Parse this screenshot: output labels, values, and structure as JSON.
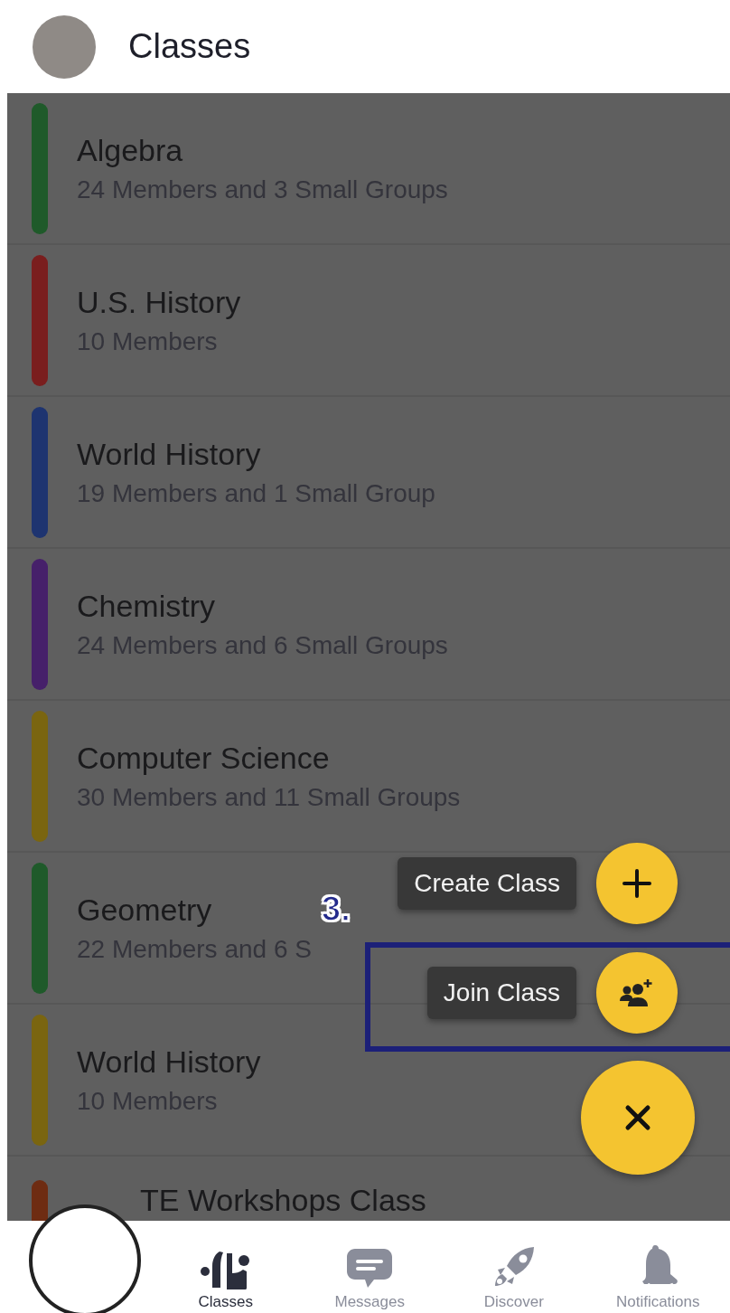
{
  "header": {
    "title": "Classes"
  },
  "classes": [
    {
      "name": "Algebra",
      "details": "24 Members and 3 Small Groups",
      "color": "#1f5a2a"
    },
    {
      "name": "U.S. History",
      "details": "10 Members",
      "color": "#7a1e1e"
    },
    {
      "name": "World History",
      "details": "19 Members and 1 Small Group",
      "color": "#1e3470"
    },
    {
      "name": "Chemistry",
      "details": "24 Members and 6 Small Groups",
      "color": "#46206a"
    },
    {
      "name": "Computer Science",
      "details": "30 Members and 11 Small Groups",
      "color": "#7a6510"
    },
    {
      "name": "Geometry",
      "details": "22 Members and 6 S",
      "color": "#1f5a2a"
    },
    {
      "name": "World History",
      "details": "10 Members",
      "color": "#7a6510"
    },
    {
      "name": "TE Workshops Class",
      "color": "#6e2c12"
    }
  ],
  "fab_menu": {
    "expanded": true,
    "actions": [
      {
        "label": "Create Class",
        "kind": "create"
      },
      {
        "label": "Join Class",
        "kind": "join"
      }
    ]
  },
  "annotation": {
    "step": "3."
  },
  "nav": [
    {
      "label": "Classes",
      "kind": "classes",
      "selected": true
    },
    {
      "label": "Messages",
      "kind": "messages",
      "selected": false
    },
    {
      "label": "Discover",
      "kind": "discover",
      "selected": false
    },
    {
      "label": "Notifications",
      "kind": "notifications",
      "selected": false
    }
  ]
}
